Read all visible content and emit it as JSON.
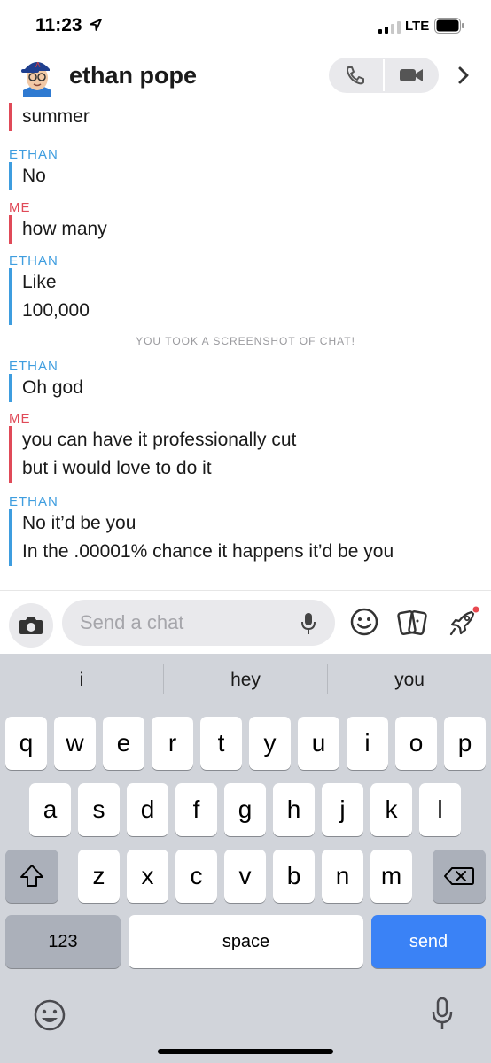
{
  "status_bar": {
    "time": "11:23",
    "network": "LTE"
  },
  "header": {
    "contact_name": "ethan pope"
  },
  "chat": {
    "partial_top_line": "summer",
    "messages": [
      {
        "sender": "ETHAN",
        "lines": [
          "No"
        ]
      },
      {
        "sender": "ME",
        "lines": [
          "how many"
        ]
      },
      {
        "sender": "ETHAN",
        "lines": [
          "Like",
          "100,000"
        ]
      },
      {
        "sender": "ETHAN",
        "lines": [
          "Oh god"
        ]
      },
      {
        "sender": "ME",
        "lines": [
          "you can have it professionally cut",
          "but i would love to do it"
        ]
      },
      {
        "sender": "ETHAN",
        "lines": [
          "No it’d be you",
          "In the .00001% chance it happens it’d be you"
        ]
      }
    ],
    "screenshot_notice": "YOU TOOK A SCREENSHOT OF CHAT!"
  },
  "input_bar": {
    "placeholder": "Send a chat"
  },
  "keyboard": {
    "suggestions": [
      "i",
      "hey",
      "you"
    ],
    "row1": [
      "q",
      "w",
      "e",
      "r",
      "t",
      "y",
      "u",
      "i",
      "o",
      "p"
    ],
    "row2": [
      "a",
      "s",
      "d",
      "f",
      "g",
      "h",
      "j",
      "k",
      "l"
    ],
    "row3": [
      "z",
      "x",
      "c",
      "v",
      "b",
      "n",
      "m"
    ],
    "numbers_key": "123",
    "space_key": "space",
    "send_key": "send"
  },
  "colors": {
    "ethan": "#3e9ddf",
    "me": "#e04a58",
    "send": "#3a82f6"
  },
  "icons": [
    "location-arrow-icon",
    "signal-icon",
    "battery-icon",
    "avatar",
    "phone-icon",
    "video-icon",
    "chevron-right-icon",
    "camera-icon",
    "microphone-icon",
    "smiley-icon",
    "cards-icon",
    "rocket-icon",
    "shift-icon",
    "backspace-icon",
    "emoji-icon",
    "dictation-icon"
  ]
}
